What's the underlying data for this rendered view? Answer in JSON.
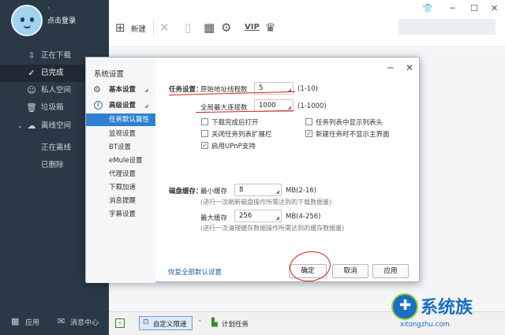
{
  "sidebar": {
    "user": {
      "nick": "·",
      "login_label": "点击登录"
    },
    "items": [
      {
        "label": "正在下载",
        "icon": "download-icon"
      },
      {
        "label": "已完成",
        "icon": "check-circle-icon"
      },
      {
        "label": "私人空间",
        "icon": "person-icon"
      },
      {
        "label": "垃圾箱",
        "icon": "trash-icon"
      },
      {
        "label": "离线空间",
        "icon": "cloud-icon"
      }
    ],
    "subitems": [
      "正在离线",
      "已删除"
    ],
    "bottom": {
      "apps_label": "应用",
      "messages_label": "消息中心"
    }
  },
  "toolbar": {
    "new_label": "新建",
    "vip_label": "VIP"
  },
  "window": {
    "controls": [
      "shirt-icon",
      "minimize-icon",
      "maximize-icon",
      "close-icon"
    ]
  },
  "bottombar": {
    "speed_label": "自定义限速",
    "schedule_label": "计划任务"
  },
  "dialog": {
    "title": "系统设置",
    "nav": {
      "basic": "基本设置",
      "advanced": "高级设置",
      "items": [
        "任务默认属性",
        "监视设置",
        "BT设置",
        "eMule设置",
        "代理设置",
        "下载加速",
        "消息提醒",
        "字幕设置"
      ]
    },
    "task": {
      "section_label": "任务设置：",
      "threads_label": "原始地址线程数",
      "threads_value": "5",
      "threads_range": "(1-10)",
      "conn_label": "全局最大连接数",
      "conn_value": "1000",
      "conn_range": "(1-1000)",
      "options": [
        {
          "label": "下载完成后打开",
          "checked": false
        },
        {
          "label": "关闭任务列表扩展栏",
          "checked": false
        },
        {
          "label": "启用UPnP支持",
          "checked": true
        },
        {
          "label": "任务列表中显示列表头",
          "checked": false
        },
        {
          "label": "新建任务时不显示主界面",
          "checked": true
        }
      ]
    },
    "disk": {
      "section_label": "磁盘缓存：",
      "min_label": "最小缓存",
      "min_value": "8",
      "min_range": "MB(2-16)",
      "min_hint": "(进行一次刷新磁盘操作所需达到的下载数据量)",
      "max_label": "最大缓存",
      "max_value": "256",
      "max_range": "MB(4-256)",
      "max_hint": "(进行一次清理缓存数据操作所需达到的缓存数据量)"
    },
    "restore_label": "恢复全部默认设置",
    "ok_label": "确定",
    "cancel_label": "取消",
    "apply_label": "应用"
  },
  "watermark": {
    "brand": "系统族",
    "url": "xitongzhu.com"
  },
  "colors": {
    "sidebar_bg": "#2b3845",
    "selection": "#2f80d1",
    "annotation_red": "#d21f1f"
  }
}
